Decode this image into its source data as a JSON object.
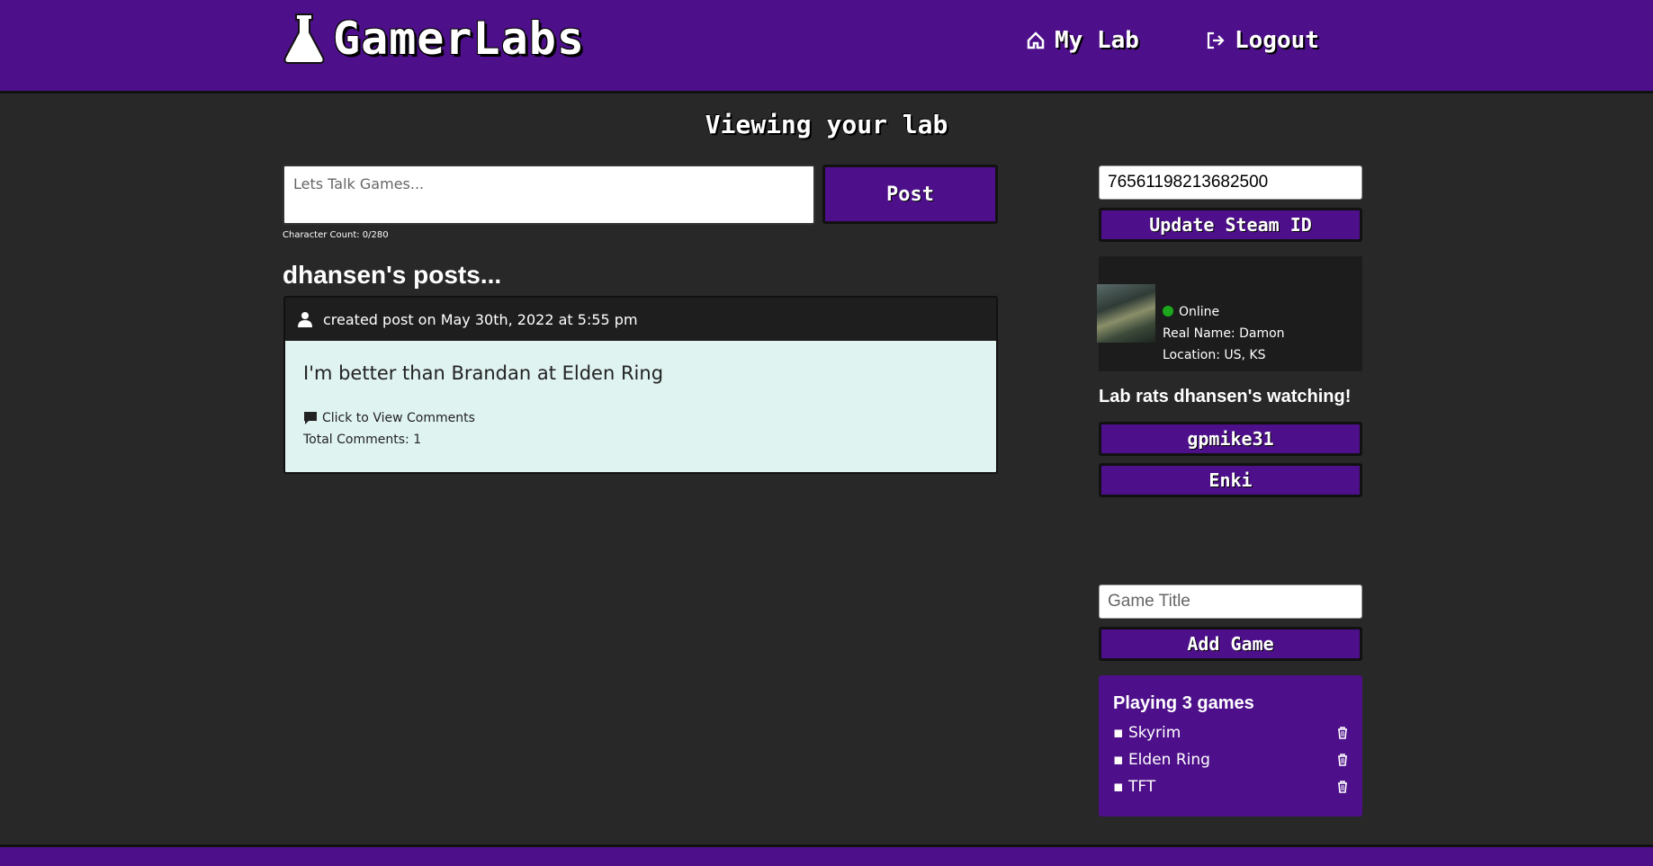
{
  "header": {
    "logo_text": "GamerLabs",
    "nav_mylab": "My Lab",
    "nav_logout": "Logout"
  },
  "page": {
    "heading": "Viewing your lab"
  },
  "composer": {
    "placeholder": "Lets Talk Games...",
    "char_count": "Character Count: 0/280",
    "post_label": "Post"
  },
  "posts": {
    "heading": "dhansen's posts...",
    "items": [
      {
        "meta": "created post on May 30th, 2022 at 5:55 pm",
        "text": "I'm better than Brandan at Elden Ring",
        "comments_link": "Click to View Comments",
        "total_comments": "Total Comments: 1"
      }
    ]
  },
  "sidebar": {
    "steam_id_value": "76561198213682500",
    "update_steam_label": "Update Steam ID",
    "steam": {
      "status": "Online",
      "status_color": "#1ba81b",
      "real_name": "Real Name: Damon",
      "location": "Location: US, KS"
    },
    "watching_heading": "Lab rats dhansen's watching!",
    "watching": [
      "gpmike31",
      "Enki"
    ],
    "game_placeholder": "Game Title",
    "add_game_label": "Add Game",
    "games_heading": "Playing 3 games",
    "games": [
      "Skyrim",
      "Elden Ring",
      "TFT"
    ]
  },
  "colors": {
    "brand_purple": "#4d108a",
    "background": "#282828",
    "post_body": "#dff3f1"
  }
}
